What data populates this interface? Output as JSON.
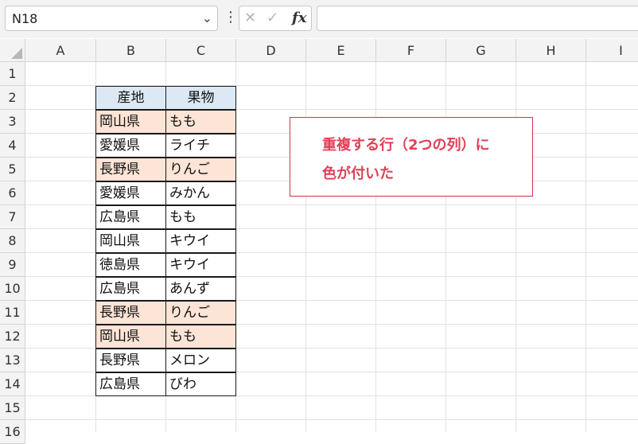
{
  "formula_bar": {
    "name_box": "N18",
    "fx_label": "fx",
    "formula_value": ""
  },
  "columns": [
    "A",
    "B",
    "C",
    "D",
    "E",
    "F",
    "G",
    "H",
    "I"
  ],
  "rows": [
    "1",
    "2",
    "3",
    "4",
    "5",
    "6",
    "7",
    "8",
    "9",
    "10",
    "11",
    "12",
    "13",
    "14",
    "15",
    "16"
  ],
  "table": {
    "headers": [
      "産地",
      "果物"
    ],
    "rows": [
      {
        "origin": "岡山県",
        "fruit": "もも",
        "highlight": true
      },
      {
        "origin": "愛媛県",
        "fruit": "ライチ",
        "highlight": false
      },
      {
        "origin": "長野県",
        "fruit": "りんご",
        "highlight": true
      },
      {
        "origin": "愛媛県",
        "fruit": "みかん",
        "highlight": false
      },
      {
        "origin": "広島県",
        "fruit": "もも",
        "highlight": false
      },
      {
        "origin": "岡山県",
        "fruit": "キウイ",
        "highlight": false
      },
      {
        "origin": "徳島県",
        "fruit": "キウイ",
        "highlight": false
      },
      {
        "origin": "広島県",
        "fruit": "あんず",
        "highlight": false
      },
      {
        "origin": "長野県",
        "fruit": "りんご",
        "highlight": true
      },
      {
        "origin": "岡山県",
        "fruit": "もも",
        "highlight": true
      },
      {
        "origin": "長野県",
        "fruit": "メロン",
        "highlight": false
      },
      {
        "origin": "広島県",
        "fruit": "びわ",
        "highlight": false
      }
    ]
  },
  "note": {
    "line1": "重複する行（2つの列）に",
    "line2": "色が付いた"
  },
  "colors": {
    "header_fill": "#dce9f5",
    "duplicate_fill": "#fce4d6",
    "note_text": "#e04058"
  }
}
